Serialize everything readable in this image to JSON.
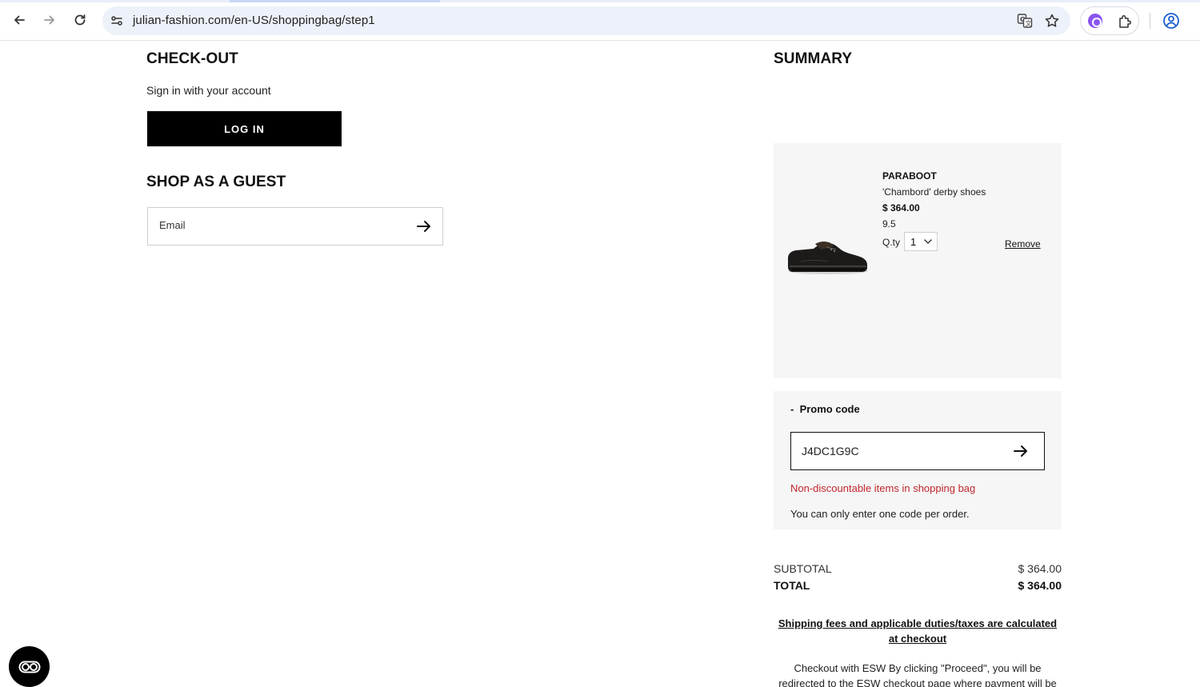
{
  "browser": {
    "url": "julian-fashion.com/en-US/shoppingbag/step1"
  },
  "checkout": {
    "title": "CHECK-OUT",
    "signin_text": "Sign in with your account",
    "login_label": "LOG IN",
    "guest_title": "SHOP AS A GUEST",
    "email_placeholder": "Email"
  },
  "summary": {
    "title": "SUMMARY",
    "item": {
      "brand": "PARABOOT",
      "name": "'Chambord' derby shoes",
      "price": "$ 364.00",
      "size": "9.5",
      "qty_label": "Q.ty",
      "qty_value": "1",
      "remove_label": "Remove"
    },
    "promo": {
      "title": "Promo code",
      "toggle": "-",
      "code_value": "J4DC1G9C",
      "error": "Non-discountable items in shopping bag",
      "note": "You can only enter one code per order."
    },
    "subtotal_label": "SUBTOTAL",
    "subtotal_value": "$ 364.00",
    "total_label": "TOTAL",
    "total_value": "$ 364.00",
    "shipping_note": "Shipping fees and applicable duties/taxes are calculated at checkout",
    "esw_text": "Checkout with ESW By clicking \"Proceed\", you will be redirected to the ESW checkout page where payment will be"
  },
  "colors": {
    "error": "#c0262d",
    "card_bg": "#f6f6f6",
    "button_bg": "#000000"
  }
}
